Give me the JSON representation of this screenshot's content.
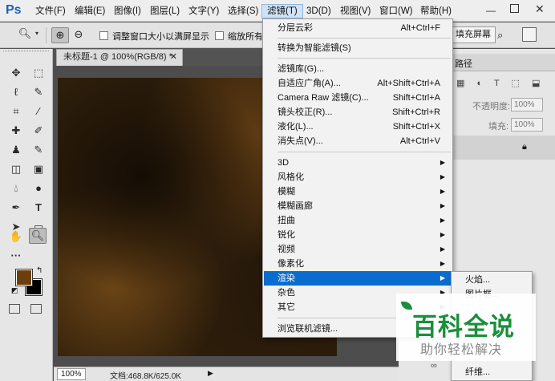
{
  "app": {
    "logo": "Ps"
  },
  "menubar": {
    "items": [
      "文件(F)",
      "编辑(E)",
      "图像(I)",
      "图层(L)",
      "文字(Y)",
      "选择(S)",
      "滤镜(T)",
      "3D(D)",
      "视图(V)",
      "窗口(W)",
      "帮助(H)"
    ],
    "active": "滤镜(T)"
  },
  "options_bar": {
    "resize_windows_label": "调整窗口大小以满屏显示",
    "zoom_all_label": "缩放所有",
    "fill_screen_label": "填充屏幕"
  },
  "document": {
    "tab_title": "未标题-1 @ 100%(RGB/8) *",
    "zoom": "100%",
    "doc_info": "文档:468.8K/625.0K"
  },
  "colors": {
    "foreground": "#6b3e0b",
    "background": "#000000",
    "menu_highlight": "#0a6ccf"
  },
  "right_panel": {
    "tab_path": "路径",
    "opacity_label": "不透明度:",
    "opacity_value": "100%",
    "fill_label": "填充:",
    "fill_value": "100%"
  },
  "filter_menu": {
    "items": [
      {
        "label": "分层云彩",
        "shortcut": "Alt+Ctrl+F"
      },
      {
        "label": "转换为智能滤镜(S)",
        "shortcut": ""
      },
      {
        "label": "滤镜库(G)...",
        "shortcut": ""
      },
      {
        "label": "自适应广角(A)...",
        "shortcut": "Alt+Shift+Ctrl+A"
      },
      {
        "label": "Camera Raw 滤镜(C)...",
        "shortcut": "Shift+Ctrl+A"
      },
      {
        "label": "镜头校正(R)...",
        "shortcut": "Shift+Ctrl+R"
      },
      {
        "label": "液化(L)...",
        "shortcut": "Shift+Ctrl+X"
      },
      {
        "label": "消失点(V)...",
        "shortcut": "Alt+Ctrl+V"
      },
      {
        "label": "3D",
        "shortcut": ""
      },
      {
        "label": "风格化",
        "shortcut": ""
      },
      {
        "label": "模糊",
        "shortcut": ""
      },
      {
        "label": "模糊画廊",
        "shortcut": ""
      },
      {
        "label": "扭曲",
        "shortcut": ""
      },
      {
        "label": "锐化",
        "shortcut": ""
      },
      {
        "label": "视频",
        "shortcut": ""
      },
      {
        "label": "像素化",
        "shortcut": ""
      },
      {
        "label": "渲染",
        "shortcut": ""
      },
      {
        "label": "杂色",
        "shortcut": ""
      },
      {
        "label": "其它",
        "shortcut": ""
      },
      {
        "label": "浏览联机滤镜...",
        "shortcut": ""
      }
    ],
    "highlighted": "渲染"
  },
  "render_submenu": {
    "items": [
      "火焰...",
      "图片框...",
      "纤维..."
    ]
  },
  "watermark": {
    "title": "百科全说",
    "subtitle": "助你轻松解决"
  }
}
